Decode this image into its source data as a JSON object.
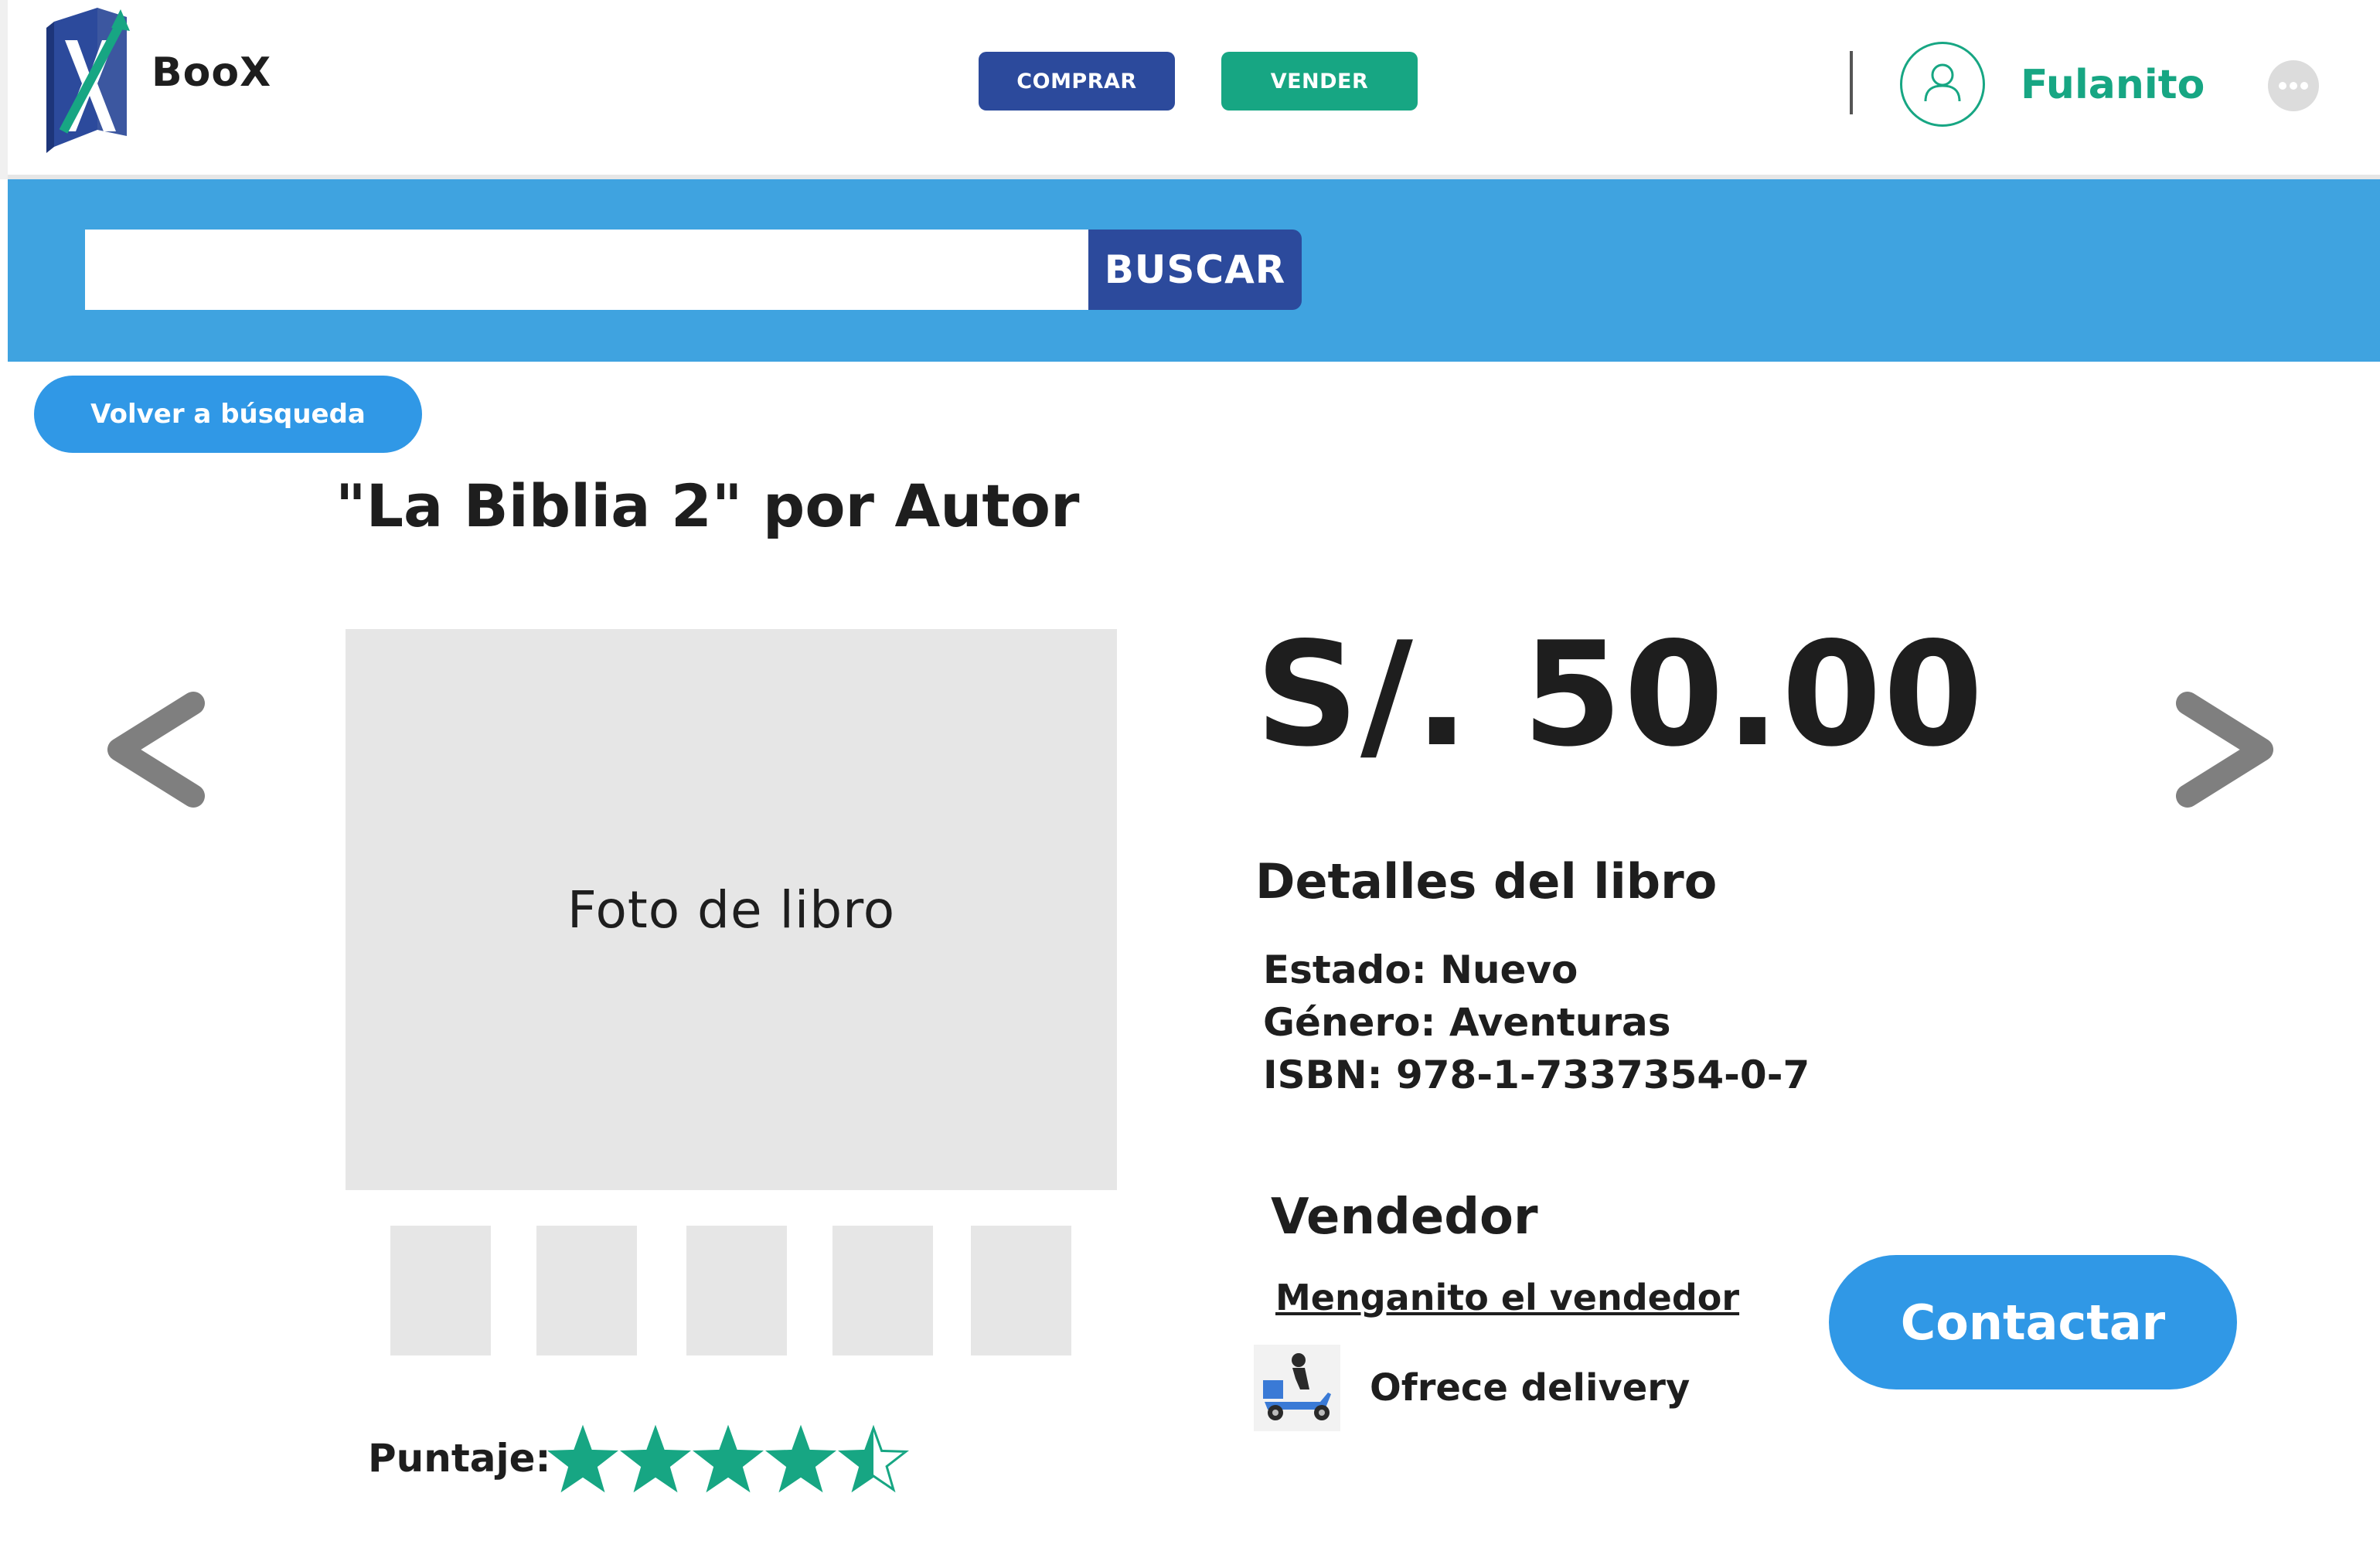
{
  "header": {
    "brand": "BooX",
    "buy_label": "COMPRAR",
    "sell_label": "VENDER",
    "username": "Fulanito"
  },
  "search": {
    "value": "",
    "placeholder": "",
    "button_label": "BUSCAR"
  },
  "nav": {
    "back_label": "Volver a búsqueda"
  },
  "book": {
    "title": "\"La Biblia 2\" por Autor",
    "photo_label": "Foto de libro",
    "thumbnail_count": 5,
    "price": "S/. 50.00",
    "details_title": "Detalles del libro",
    "details": [
      "Estado: Nuevo",
      "Género: Aventuras",
      "ISBN: 978-1-7337354-0-7"
    ],
    "rating_label": "Puntaje:",
    "rating_value": 4.5,
    "rating_max": 5
  },
  "seller": {
    "title": "Vendedor",
    "name": "Menganito el vendedor",
    "delivery_text": "Ofrece delivery",
    "contact_label": "Contactar"
  },
  "colors": {
    "primary_blue": "#2c4a9c",
    "green": "#17a683",
    "sky_blue": "#3fa3e0",
    "button_blue": "#3098e6",
    "placeholder_gray": "#e6e6e6",
    "arrow_gray": "#7f7f7f"
  },
  "icons": [
    "logo-book-icon",
    "user-icon",
    "more-icon",
    "chevron-left-icon",
    "chevron-right-icon",
    "star-icon",
    "delivery-scooter-icon"
  ]
}
